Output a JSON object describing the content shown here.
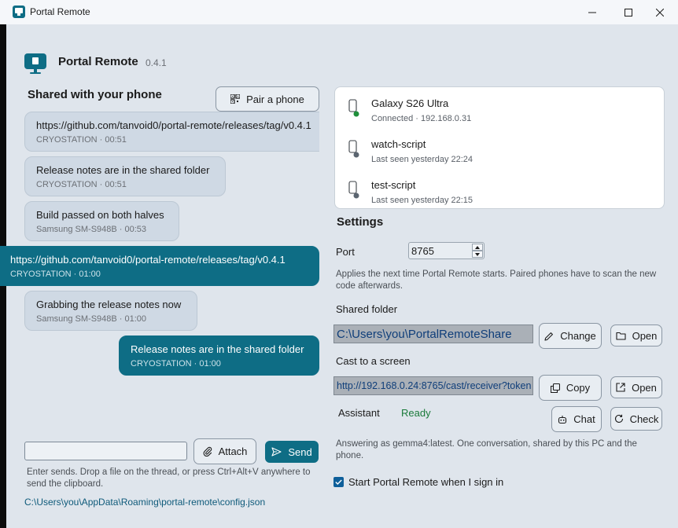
{
  "window": {
    "title": "Portal Remote"
  },
  "header": {
    "app_name": "Portal Remote",
    "version": "0.4.1"
  },
  "shared": {
    "title": "Shared with your phone",
    "pair_button": "Pair a phone",
    "messages": [
      {
        "text": "https://github.com/tanvoid0/portal-remote/releases/tag/v0.4.1",
        "meta": "CRYOSTATION · 00:51",
        "mine": false
      },
      {
        "text": "Release notes are in the shared folder",
        "meta": "CRYOSTATION · 00:51",
        "mine": false
      },
      {
        "text": "Build passed on both halves",
        "meta": "Samsung SM-S948B · 00:53",
        "mine": false
      },
      {
        "text": "https://github.com/tanvoid0/portal-remote/releases/tag/v0.4.1",
        "meta": "CRYOSTATION · 01:00",
        "mine": true
      },
      {
        "text": "Grabbing the release notes now",
        "meta": "Samsung SM-S948B · 01:00",
        "mine": false
      },
      {
        "text": "Release notes are in the shared folder",
        "meta": "CRYOSTATION · 01:00",
        "mine": true
      }
    ]
  },
  "composer": {
    "input_value": "",
    "attach_label": "Attach",
    "send_label": "Send",
    "hint": "Enter sends. Drop a file on the thread, or press Ctrl+Alt+V anywhere to send the clipboard.",
    "config_path": "C:\\Users\\you\\AppData\\Roaming\\portal-remote\\config.json"
  },
  "devices": [
    {
      "name": "Galaxy S26 Ultra",
      "status": "Connected · 192.168.0.31",
      "dot_color": "#1f8f3a"
    },
    {
      "name": "watch-script",
      "status": "Last seen yesterday 22:24",
      "dot_color": "#5b6570"
    },
    {
      "name": "test-script",
      "status": "Last seen yesterday 22:15",
      "dot_color": "#5b6570"
    }
  ],
  "settings": {
    "title": "Settings",
    "port_label": "Port",
    "port_value": "8765",
    "port_help": "Applies the next time Portal Remote starts. Paired phones have to scan the new code afterwards.",
    "folder_label": "Shared folder",
    "folder_value": "C:\\Users\\you\\PortalRemoteShare",
    "change_label": "Change",
    "open_label": "Open",
    "cast_label": "Cast to a screen",
    "cast_value": "http://192.168.0.24:8765/cast/receiver?token",
    "copy_label": "Copy",
    "open_cast_label": "Open",
    "assistant_label": "Assistant",
    "assistant_status": "Ready",
    "chat_label": "Chat",
    "check_label": "Check",
    "assistant_help": "Answering as gemma4:latest. One conversation, shared by this PC and the phone.",
    "startup_label": "Start Portal Remote when I sign in",
    "startup_checked": true
  },
  "colors": {
    "accent": "#0e6d85",
    "background": "#dfe5ec"
  }
}
